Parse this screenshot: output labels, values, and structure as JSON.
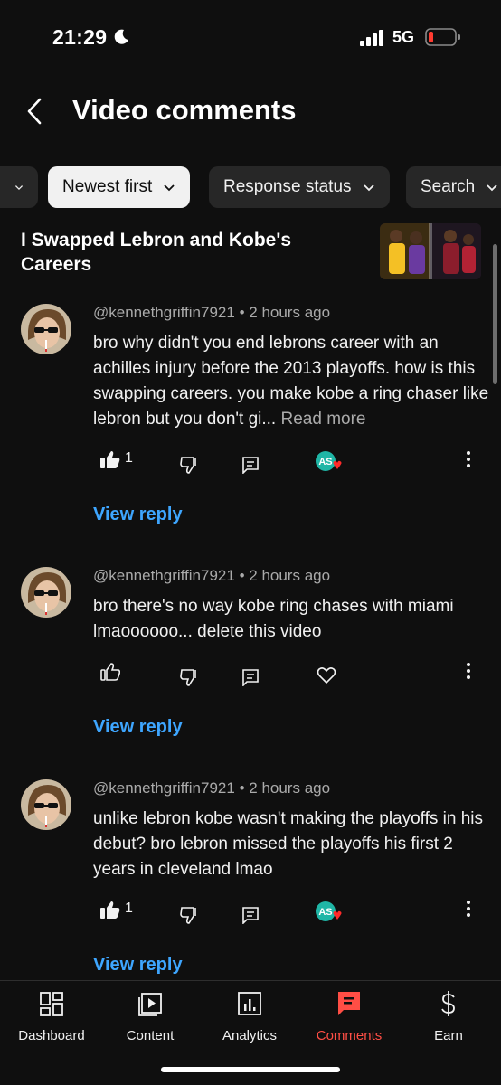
{
  "status_bar": {
    "time": "21:29",
    "network": "5G",
    "battery_color": "#ff3b30"
  },
  "header": {
    "title": "Video comments",
    "back_icon": "chevron-left-icon"
  },
  "filters": [
    {
      "label": "",
      "selected": false
    },
    {
      "label": "Newest first",
      "selected": true
    },
    {
      "label": "Response status",
      "selected": false
    },
    {
      "label": "Search",
      "selected": false
    }
  ],
  "video": {
    "title": "I Swapped Lebron and Kobe's Careers"
  },
  "comments": [
    {
      "author": "@kennethgriffin7921",
      "time": "2 hours ago",
      "text": "bro why didn't you end lebrons career with an achilles injury before the 2013 playoffs. how is this swapping careers. you make kobe a ring chaser like lebron but you don't gi...",
      "read_more": "Read more",
      "likes": "1",
      "liked": true,
      "hearted": true,
      "creator_badge": "AS",
      "view_reply": "View reply"
    },
    {
      "author": "@kennethgriffin7921",
      "time": "2 hours ago",
      "text": "bro there's no way kobe ring chases with miami lmaoooooo... delete this video",
      "likes": "",
      "liked": false,
      "hearted": false,
      "view_reply": "View reply"
    },
    {
      "author": "@kennethgriffin7921",
      "time": "2 hours ago",
      "text": "unlike lebron kobe wasn't making the playoffs in his debut? bro lebron missed the playoffs his first 2 years in cleveland lmao",
      "likes": "1",
      "liked": true,
      "hearted": true,
      "creator_badge": "AS",
      "view_reply": "View reply"
    }
  ],
  "bottom_nav": [
    {
      "label": "Dashboard",
      "icon": "dashboard-icon",
      "active": false
    },
    {
      "label": "Content",
      "icon": "content-icon",
      "active": false
    },
    {
      "label": "Analytics",
      "icon": "analytics-icon",
      "active": false
    },
    {
      "label": "Comments",
      "icon": "comments-icon",
      "active": true
    },
    {
      "label": "Earn",
      "icon": "dollar-icon",
      "active": false
    }
  ],
  "colors": {
    "accent_active": "#ff4e45",
    "link": "#3ea6ff",
    "badge": "#1fb6a6"
  }
}
